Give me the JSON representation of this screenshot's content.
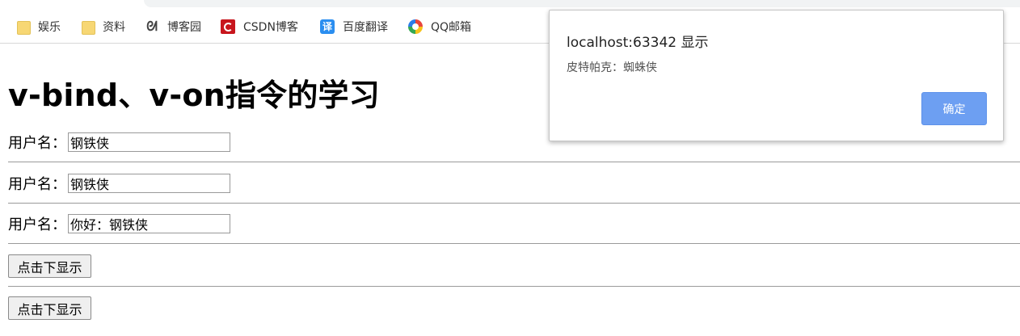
{
  "bookmarks": [
    {
      "label": "娱乐",
      "icon": "folder-icon"
    },
    {
      "label": "资料",
      "icon": "folder-icon"
    },
    {
      "label": "博客园",
      "icon": "cnblogs-icon"
    },
    {
      "label": "CSDN博客",
      "icon": "csdn-icon"
    },
    {
      "label": "百度翻译",
      "icon": "baidu-translate-icon",
      "glyph": "译"
    },
    {
      "label": "QQ邮箱",
      "icon": "qq-mail-icon"
    }
  ],
  "page": {
    "heading": "v-bind、v-on指令的学习",
    "fields": [
      {
        "label": "用户名：",
        "value": "钢铁侠"
      },
      {
        "label": "用户名：",
        "value": "钢铁侠"
      },
      {
        "label": "用户名：",
        "value": "你好：钢铁侠"
      }
    ],
    "buttons": [
      {
        "label": "点击下显示"
      },
      {
        "label": "点击下显示"
      }
    ]
  },
  "dialog": {
    "title": "localhost:63342 显示",
    "message": "皮特帕克：蜘蛛侠",
    "ok_label": "确定",
    "ok_color": "#6d9ff2"
  },
  "colors": {
    "folder": "#f7d774",
    "csdn": "#c8161d",
    "baidu_translate": "#2a8ef0"
  }
}
